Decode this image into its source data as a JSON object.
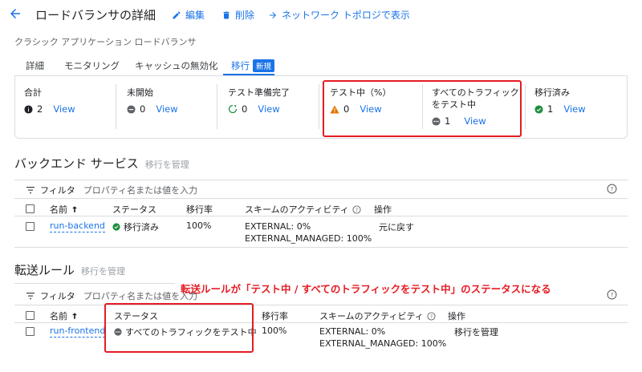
{
  "header": {
    "title": "ロードバランサの詳細",
    "edit_label": "編集",
    "delete_label": "削除",
    "topology_label": "ネットワーク トポロジで表示"
  },
  "subtitle": "クラシック アプリケーション ロードバランサ",
  "tabs": [
    {
      "label": "詳細"
    },
    {
      "label": "モニタリング"
    },
    {
      "label": "キャッシュの無効化"
    },
    {
      "label": "移行",
      "badge": "新規",
      "active": true
    }
  ],
  "summary": [
    {
      "label": "合計",
      "count": "2",
      "link": "View",
      "icon": "info-icon"
    },
    {
      "label": "未開始",
      "count": "0",
      "link": "View",
      "icon": "not-started-icon"
    },
    {
      "label": "テスト準備完了",
      "count": "0",
      "link": "View",
      "icon": "ready-icon"
    },
    {
      "label": "テスト中（%）",
      "count": "0",
      "link": "View",
      "icon": "warning-icon"
    },
    {
      "label_line1": "すべてのトラフィック",
      "label_line2": "をテスト中",
      "count": "1",
      "link": "View",
      "icon": "testing-all-icon"
    },
    {
      "label": "移行済み",
      "count": "1",
      "link": "View",
      "icon": "check-icon"
    }
  ],
  "backend": {
    "title": "バックエンド サービス",
    "manage_link": "移行を管理",
    "filter_label": "フィルタ",
    "filter_placeholder": "プロパティ名または値を入力",
    "columns": [
      "名前",
      "ステータス",
      "移行率",
      "スキームのアクティビティ",
      "操作"
    ],
    "rows": [
      {
        "name": "run-backend",
        "status": "移行済み",
        "rate": "100%",
        "scheme1": "EXTERNAL: 0%",
        "scheme2": "EXTERNAL_MANAGED: 100%",
        "action": "元に戻す"
      }
    ]
  },
  "forwarding": {
    "title": "転送ルール",
    "manage_link": "移行を管理",
    "filter_label": "フィルタ",
    "filter_placeholder": "プロパティ名または値を入力",
    "columns": [
      "名前",
      "ステータス",
      "移行率",
      "スキームのアクティビティ",
      "操作"
    ],
    "rows": [
      {
        "name": "run-frontend",
        "status": "すべてのトラフィックをテスト中",
        "rate": "100%",
        "scheme1": "EXTERNAL: 0%",
        "scheme2": "EXTERNAL_MANAGED: 100%",
        "action": "移行を管理"
      }
    ]
  },
  "annotation": "転送ルールが「テスト中 / すべてのトラフィックをテスト中」のステータスになる",
  "colors": {
    "accent": "#1a73e8",
    "highlight": "#e51c23",
    "success": "#1e8e3e",
    "warning": "#e37400"
  }
}
